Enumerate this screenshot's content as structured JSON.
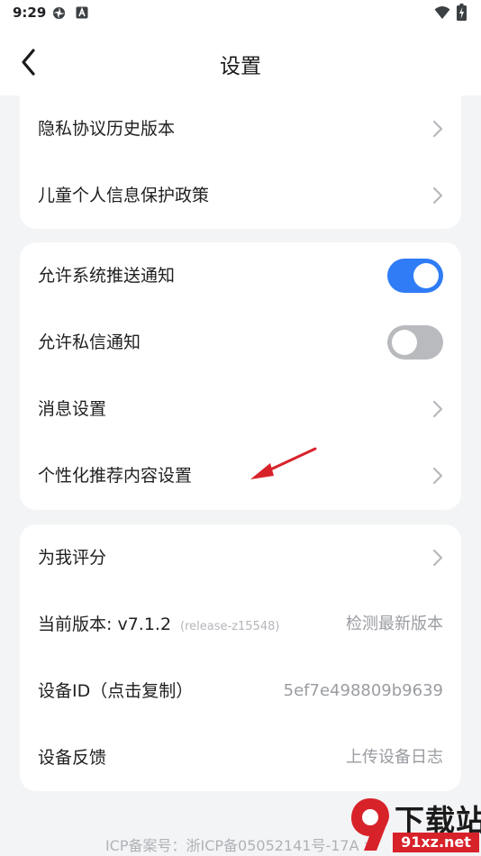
{
  "status_bar": {
    "time": "9:29",
    "left_icons": [
      "pinwheel-icon",
      "app-a-icon"
    ],
    "right_icons": [
      "wifi-icon",
      "battery-charging-icon"
    ]
  },
  "header": {
    "title": "设置",
    "back_icon": "chevron-left-icon"
  },
  "sections": [
    {
      "rows": [
        {
          "label": "隐私协议历史版本",
          "action": "chevron"
        },
        {
          "label": "儿童个人信息保护政策",
          "action": "chevron"
        }
      ]
    },
    {
      "rows": [
        {
          "label": "允许系统推送通知",
          "toggle": true
        },
        {
          "label": "允许私信通知",
          "toggle": false
        },
        {
          "label": "消息设置",
          "action": "chevron"
        },
        {
          "label": "个性化推荐内容设置",
          "action": "chevron"
        }
      ]
    },
    {
      "rows": [
        {
          "label": "为我评分",
          "action": "chevron"
        },
        {
          "label": "当前版本:",
          "value": "v7.1.2",
          "tag": "(release-z15548)",
          "right_text": "检测最新版本"
        },
        {
          "label": "设备ID（点击复制）",
          "right_text": "5ef7e498809b9639"
        },
        {
          "label": "设备反馈",
          "right_text": "上传设备日志"
        }
      ]
    }
  ],
  "footer": {
    "icp": "ICP备案号：浙ICP备05052141号-17A >"
  },
  "watermark": {
    "title": "下载站",
    "domain": "91xz.net"
  },
  "colors": {
    "accent": "#2f7cf6",
    "toggle_off": "#b8babd",
    "background": "#f3f4f6",
    "card": "#ffffff",
    "annotation_arrow": "#d8222a"
  }
}
